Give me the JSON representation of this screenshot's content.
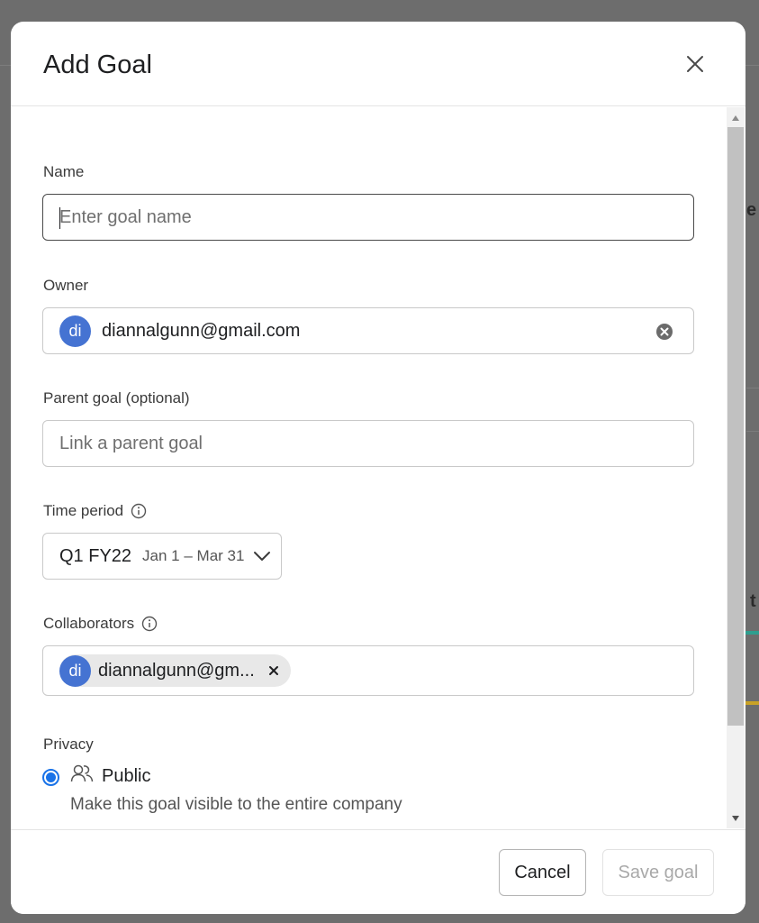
{
  "modal": {
    "title": "Add Goal",
    "close_icon": "close-icon"
  },
  "fields": {
    "name": {
      "label": "Name",
      "placeholder": "Enter goal name",
      "value": ""
    },
    "owner": {
      "label": "Owner",
      "avatar_initials": "di",
      "email": "diannalgunn@gmail.com",
      "clear_icon": "clear-circle-icon"
    },
    "parent_goal": {
      "label": "Parent goal (optional)",
      "placeholder": "Link a parent goal",
      "value": ""
    },
    "time_period": {
      "label": "Time period",
      "info_icon": "info-icon",
      "quarter": "Q1 FY22",
      "range": "Jan 1 – Mar 31",
      "chevron_icon": "chevron-down-icon"
    },
    "collaborators": {
      "label": "Collaborators",
      "info_icon": "info-icon",
      "chips": [
        {
          "initials": "di",
          "text": "diannalgunn@gm..."
        }
      ]
    },
    "privacy": {
      "label": "Privacy",
      "options": [
        {
          "label": "Public",
          "description": "Make this goal visible to the entire company",
          "selected": true,
          "icon": "people-icon"
        }
      ]
    }
  },
  "footer": {
    "cancel_label": "Cancel",
    "save_label": "Save goal",
    "save_disabled": true
  },
  "colors": {
    "accent": "#4573d2",
    "radio": "#1a73e8",
    "overlay": "#6a6a6a"
  }
}
